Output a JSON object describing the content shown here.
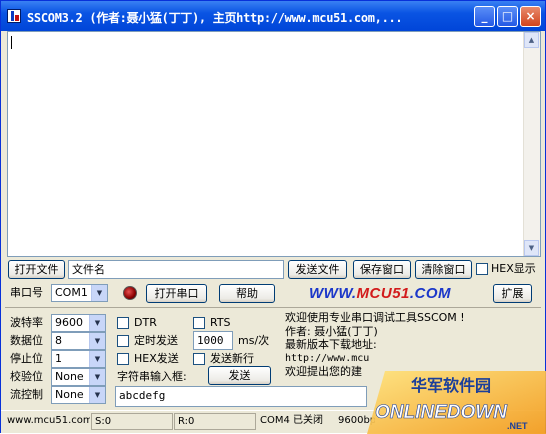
{
  "window": {
    "title": "SSCOM3.2 (作者:聂小猛(丁丁), 主页http://www.mcu51.com,...",
    "controls": {
      "minimize": "_",
      "maximize": "□",
      "close": "×"
    }
  },
  "toolbar": {
    "open_file_label": "打开文件",
    "file_name_value": "文件名",
    "send_file_label": "发送文件",
    "save_window_label": "保存窗口",
    "clear_window_label": "清除窗口",
    "hex_display_label": "HEX显示"
  },
  "port_row": {
    "port_label": "串口号",
    "port_value": "COM1",
    "open_port_label": "打开串口",
    "help_label": "帮助",
    "brand_main": "WWW.",
    "brand_accent": "MCU51",
    "brand_tail": ".COM",
    "expand_label": "扩展"
  },
  "settings": {
    "baud_label": "波特率",
    "baud_value": "9600",
    "data_bits_label": "数据位",
    "data_bits_value": "8",
    "stop_bits_label": "停止位",
    "stop_bits_value": "1",
    "parity_label": "校验位",
    "parity_value": "None",
    "flow_label": "流控制",
    "flow_value": "None"
  },
  "options": {
    "dtr_label": "DTR",
    "rts_label": "RTS",
    "timed_send_label": "定时发送",
    "interval_value": "1000",
    "interval_unit": "ms/次",
    "hex_send_label": "HEX发送",
    "send_newline_label": "发送新行",
    "input_label": "字符串输入框:",
    "send_label": "发送",
    "input_value": "abcdefg"
  },
  "info": {
    "line1": "欢迎使用专业串口调试工具SSCOM !",
    "line2": "作者: 聂小猛(丁丁)",
    "line3": "最新版本下载地址:",
    "line4": "http://www.mcu",
    "line5": "欢迎提出您的建"
  },
  "statusbar": {
    "site": "www.mcu51.com",
    "sent": "S:0",
    "received": "R:0",
    "port_status": "COM4 已关闭",
    "settings": "9600bps"
  },
  "watermark": {
    "cn_text": "华军软件园",
    "en_text": "ONLINEDOWN",
    "suffix": ".NET"
  },
  "colors": {
    "titlebar": "#0a54e3",
    "brand_blue": "#1b37c9",
    "brand_red": "#d21b1b"
  }
}
